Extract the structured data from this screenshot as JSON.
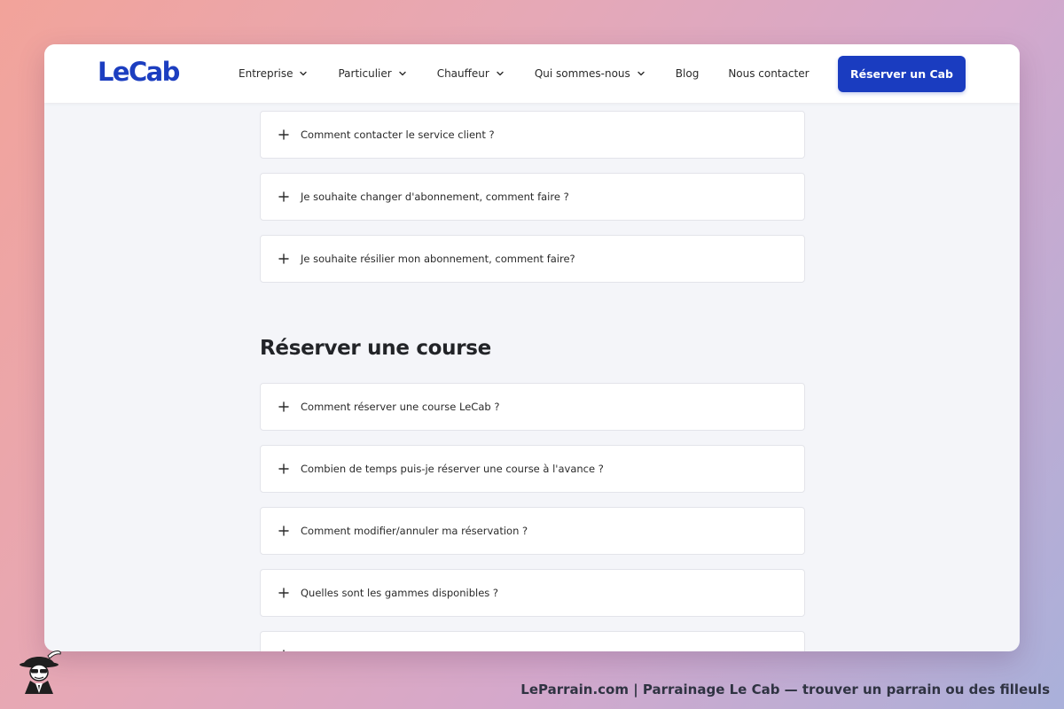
{
  "brand": {
    "logo_text": "LeCab",
    "accent_color": "#1a3cc0"
  },
  "nav": {
    "items": [
      {
        "label": "Entreprise",
        "has_dropdown": true
      },
      {
        "label": "Particulier",
        "has_dropdown": true
      },
      {
        "label": "Chauffeur",
        "has_dropdown": true
      },
      {
        "label": "Qui sommes-nous",
        "has_dropdown": true
      },
      {
        "label": "Blog",
        "has_dropdown": false
      },
      {
        "label": "Nous contacter",
        "has_dropdown": false
      }
    ],
    "cta_label": "Réserver un Cab"
  },
  "faq_top": [
    {
      "question": "Comment contacter le service client ?",
      "icon": "plus-icon"
    },
    {
      "question": "Je souhaite changer d'abonnement, comment faire ?",
      "icon": "plus-icon"
    },
    {
      "question": "Je souhaite résilier mon abonnement, comment faire?",
      "icon": "plus-icon"
    }
  ],
  "section": {
    "title": "Réserver une course",
    "faq": [
      {
        "question": "Comment réserver une course LeCab ?",
        "icon": "plus-icon"
      },
      {
        "question": "Combien de temps puis-je réserver une course à l'avance ?",
        "icon": "plus-icon"
      },
      {
        "question": "Comment modifier/annuler ma réservation ?",
        "icon": "plus-icon"
      },
      {
        "question": "Quelles sont les gammes disponibles ?",
        "icon": "plus-icon"
      },
      {
        "question": "",
        "icon": "plus-icon"
      }
    ]
  },
  "footer": {
    "caption": "LeParrain.com | Parrainage Le Cab — trouver un parrain ou des filleuls",
    "mascot_icon": "mascot-logo-icon"
  }
}
